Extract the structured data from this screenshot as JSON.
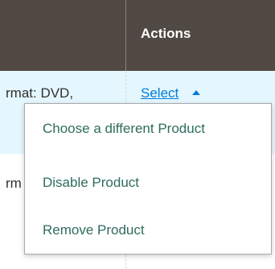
{
  "table": {
    "header": {
      "actions_label": "Actions"
    },
    "rows": [
      {
        "cell_text": "rmat: DVD,"
      },
      {
        "cell_text": "rm"
      }
    ],
    "select_link_label": "Select"
  },
  "dropdown": {
    "items": [
      {
        "label": "Choose a different Product"
      },
      {
        "label": "Disable Product"
      },
      {
        "label": "Remove Product"
      }
    ]
  },
  "colors": {
    "header_bg": "#514943",
    "row_highlight_bg": "#e5f7fe",
    "link": "#007bdb",
    "menu_text": "#2f6c5e"
  },
  "icons": {
    "select_caret": "caret-up-icon"
  }
}
